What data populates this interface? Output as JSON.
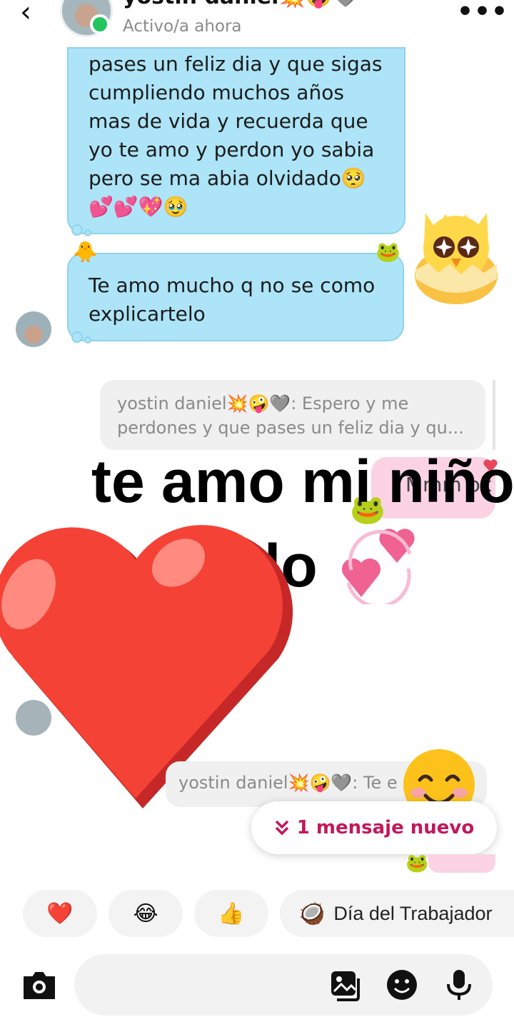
{
  "header": {
    "back_icon": "chevron-left-icon",
    "contact_name": "yostin daniel💥🤪🩶",
    "status": "Activo/a ahora",
    "more_icon": "more-dots-icon"
  },
  "messages": {
    "bubble1_lines": [
      "pases un feliz dia y que sigas",
      "cumpliendo muchos años",
      "mas de vida y recuerda que",
      "yo te amo y perdon yo sabia",
      "pero se ma abia olvidado🥺",
      "💕💕💖🥹"
    ],
    "bubble2_lines": [
      "Te amo mucho q no se como",
      "explicartelo"
    ],
    "reply_preview_lines": [
      "yostin daniel💥🤪🩶: Espero y me",
      "perdones  y que pases un feliz dia y qu..."
    ],
    "pink_bubble": "Mmm ok",
    "reply_preview2": "yostin daniel💥🤪🩶: Te e"
  },
  "overlay": {
    "line1": "te amo mi niño",
    "line2": "lo"
  },
  "new_message_pill": {
    "icon": "double-chevron-down-icon",
    "label": "1 mensaje nuevo"
  },
  "quick_reactions": [
    {
      "emoji": "❤️"
    },
    {
      "emoji": "😂"
    },
    {
      "emoji": "👍"
    },
    {
      "emoji": "🥥",
      "label": "Día del Trabajador"
    }
  ],
  "composer": {
    "camera_icon": "camera-icon",
    "gallery_icon": "gallery-icon",
    "sticker_icon": "sticker-icon",
    "mic_icon": "microphone-icon"
  },
  "colors": {
    "bubble_blue": "#ade4f7",
    "bubble_pink": "#fbd3e3",
    "accent": "#c2185b",
    "online": "#22c55e"
  }
}
